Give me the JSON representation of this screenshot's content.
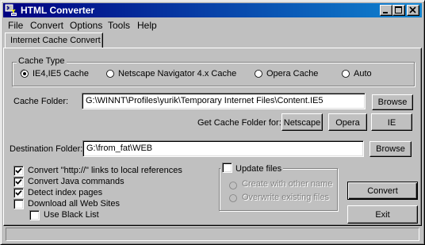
{
  "window": {
    "title": "HTML Converter",
    "icon": "html-converter-app-icon",
    "controls": [
      "minimize-icon",
      "maximize-icon",
      "close-icon"
    ]
  },
  "menu": {
    "file": "File",
    "convert": "Convert",
    "options": "Options",
    "tools": "Tools",
    "help": "Help"
  },
  "tabs": [
    {
      "label": "Internet Cache Convert",
      "selected": true
    }
  ],
  "cache_type": {
    "title": "Cache Type",
    "options": [
      {
        "label": "IE4,IE5 Cache",
        "selected": true
      },
      {
        "label": "Netscape Navigator 4.x Cache",
        "selected": false
      },
      {
        "label": "Opera Cache",
        "selected": false
      },
      {
        "label": "Auto",
        "selected": false
      }
    ]
  },
  "cache_folder": {
    "label": "Cache Folder:",
    "value": "G:\\WINNT\\Profiles\\yurik\\Temporary Internet Files\\Content.IE5",
    "browse": "Browse",
    "get_label": "Get Cache Folder for:",
    "netscape": "Netscape",
    "opera": "Opera",
    "ie": "IE"
  },
  "destination": {
    "label": "Destination Folder:",
    "value": "G:\\from_fat\\WEB",
    "browse": "Browse"
  },
  "options": [
    {
      "label": "Convert \"http://\" links to local references",
      "checked": true
    },
    {
      "label": "Convert Java commands",
      "checked": true
    },
    {
      "label": "Detect index pages",
      "checked": true
    },
    {
      "label": "Download all Web Sites",
      "checked": false
    },
    {
      "label": "Use Black List",
      "checked": false
    }
  ],
  "update_files": {
    "label": "Update files",
    "checked": false,
    "options": [
      {
        "label": "Create with other name",
        "enabled": false
      },
      {
        "label": "Overwrite existing files",
        "enabled": false
      }
    ]
  },
  "actions": {
    "convert": "Convert",
    "exit": "Exit"
  },
  "status": ""
}
